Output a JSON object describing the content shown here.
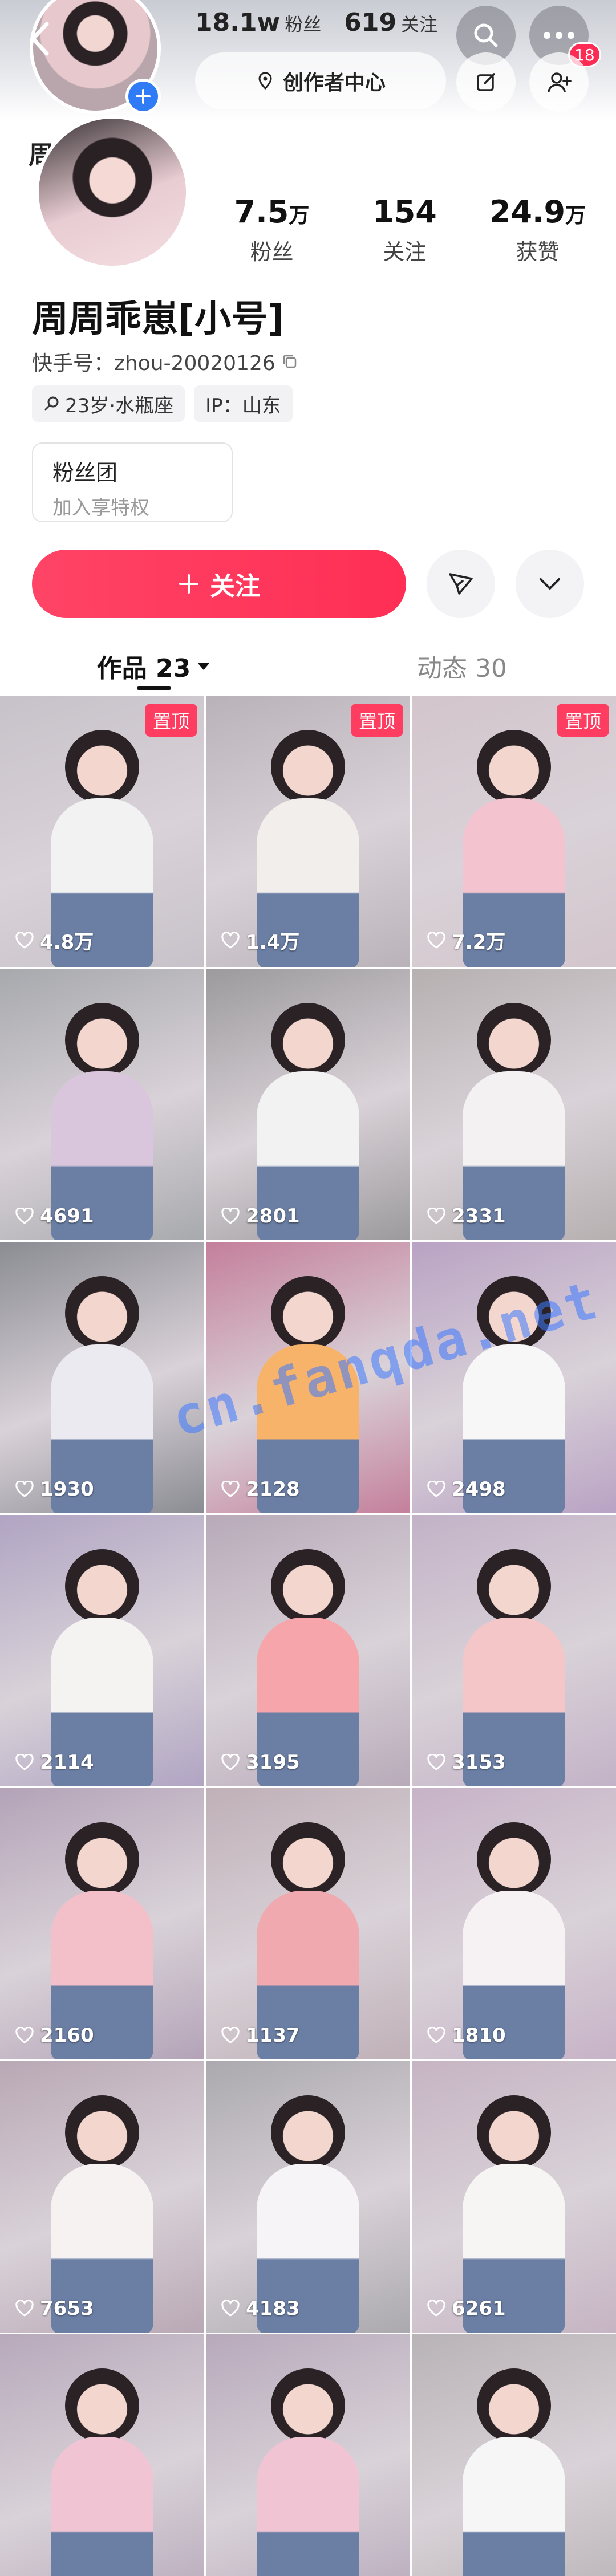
{
  "header": {
    "followers_short": "18.1w",
    "followers_label": "粉丝",
    "following_count": "619",
    "following_label": "关注",
    "creator_center": "创作者中心",
    "notification_badge": "18"
  },
  "profile": {
    "name_cut": "周",
    "name": "周周乖崽[小号]",
    "kuaishou_id_label": "快手号：",
    "kuaishou_id": "zhou-20020126",
    "age_tag": "23岁·水瓶座",
    "ip_tag": "IP：山东",
    "stats": [
      {
        "num": "7.5",
        "unit": "万",
        "label": "粉丝"
      },
      {
        "num": "154",
        "unit": "",
        "label": "关注"
      },
      {
        "num": "24.9",
        "unit": "万",
        "label": "获赞"
      }
    ],
    "fanclub_title": "粉丝团",
    "fanclub_subtitle": "加入享特权",
    "follow_button": "关注"
  },
  "tabs": [
    {
      "label": "作品 23"
    },
    {
      "label": "动态 30"
    }
  ],
  "pinned_label": "置顶",
  "watermark_text": "cn.fanqda.net",
  "videos": [
    {
      "likes": "4.8万",
      "pinned": true,
      "bg": "#c7c2c9",
      "top": "#f2f2f3"
    },
    {
      "likes": "1.4万",
      "pinned": true,
      "bg": "#b9b3b9",
      "top": "#f1eeec"
    },
    {
      "likes": "7.2万",
      "pinned": true,
      "bg": "#d3c5cc",
      "top": "#f3c3cf"
    },
    {
      "likes": "4691",
      "pinned": false,
      "bg": "#a7a9ad",
      "top": "#d9c6dd"
    },
    {
      "likes": "2801",
      "pinned": false,
      "bg": "#9c9a9d",
      "top": "#f2f2f3"
    },
    {
      "likes": "2331",
      "pinned": false,
      "bg": "#b6b0b1",
      "top": "#f3f1f1"
    },
    {
      "likes": "1930",
      "pinned": false,
      "bg": "#8b8c93",
      "top": "#eaeaf0"
    },
    {
      "likes": "2128",
      "pinned": false,
      "bg": "#c47f9b",
      "top": "#f7b36a"
    },
    {
      "likes": "2498",
      "pinned": false,
      "bg": "#b9a2c4",
      "top": "#f7f7f7"
    },
    {
      "likes": "2114",
      "pinned": false,
      "bg": "#b0a4c3",
      "top": "#f5f2f2"
    },
    {
      "likes": "3195",
      "pinned": false,
      "bg": "#b8aab9",
      "top": "#f6a6ab"
    },
    {
      "likes": "3153",
      "pinned": false,
      "bg": "#c3b2c7",
      "top": "#f4c6c8"
    },
    {
      "likes": "2160",
      "pinned": false,
      "bg": "#b4a3b8",
      "top": "#f3c0c9"
    },
    {
      "likes": "1137",
      "pinned": false,
      "bg": "#c0b0b8",
      "top": "#f1a9b0"
    },
    {
      "likes": "1810",
      "pinned": false,
      "bg": "#c7b3c7",
      "top": "#f6f1f2"
    },
    {
      "likes": "7653",
      "pinned": false,
      "bg": "#b9a8b5",
      "top": "#f7f2f2"
    },
    {
      "likes": "4183",
      "pinned": false,
      "bg": "#aba9ae",
      "top": "#f6f4f6"
    },
    {
      "likes": "6261",
      "pinned": false,
      "bg": "#c6b4c3",
      "top": "#f7f4f4"
    },
    {
      "likes": "",
      "pinned": false,
      "bg": "#b7a9bb",
      "top": "#f1c4d4"
    },
    {
      "likes": "",
      "pinned": false,
      "bg": "#b7a9bb",
      "top": "#f1c4d4"
    },
    {
      "likes": "",
      "pinned": false,
      "bg": "#b8b3b6",
      "top": "#f6f6f6"
    }
  ]
}
